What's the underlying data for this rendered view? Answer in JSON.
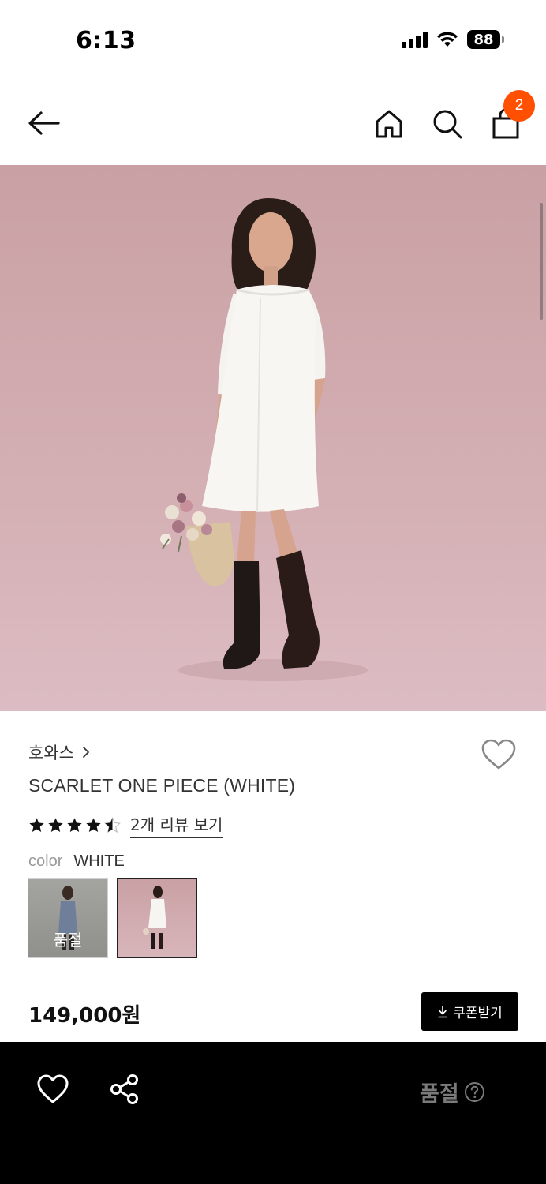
{
  "status_bar": {
    "time": "6:13",
    "battery": "88",
    "icons": [
      "cellular-signal-icon",
      "wifi-icon",
      "battery-icon"
    ]
  },
  "header": {
    "icons": [
      "back-arrow-icon",
      "home-icon",
      "search-icon",
      "shopping-bag-icon"
    ],
    "cart_count": "2",
    "badge_color": "#ff4f00"
  },
  "product": {
    "brand": "호와스",
    "name": "SCARLET ONE PIECE (WHITE)",
    "rating": 4.5,
    "review_link": "2개 리뷰 보기",
    "color_label": "color",
    "color_value": "WHITE",
    "swatches": [
      {
        "color": "gray",
        "overlay": "품절",
        "selected": false
      },
      {
        "color": "white",
        "overlay": "",
        "selected": true
      }
    ],
    "price": "149,000원",
    "coupon_button": "쿠폰받기"
  },
  "bottom_bar": {
    "status": "품절",
    "icons": [
      "heart-icon",
      "share-icon",
      "help-circle-icon"
    ]
  },
  "colors": {
    "accent": "#ff4f00",
    "bottom_bar_bg": "#000000",
    "text": "#333333"
  }
}
